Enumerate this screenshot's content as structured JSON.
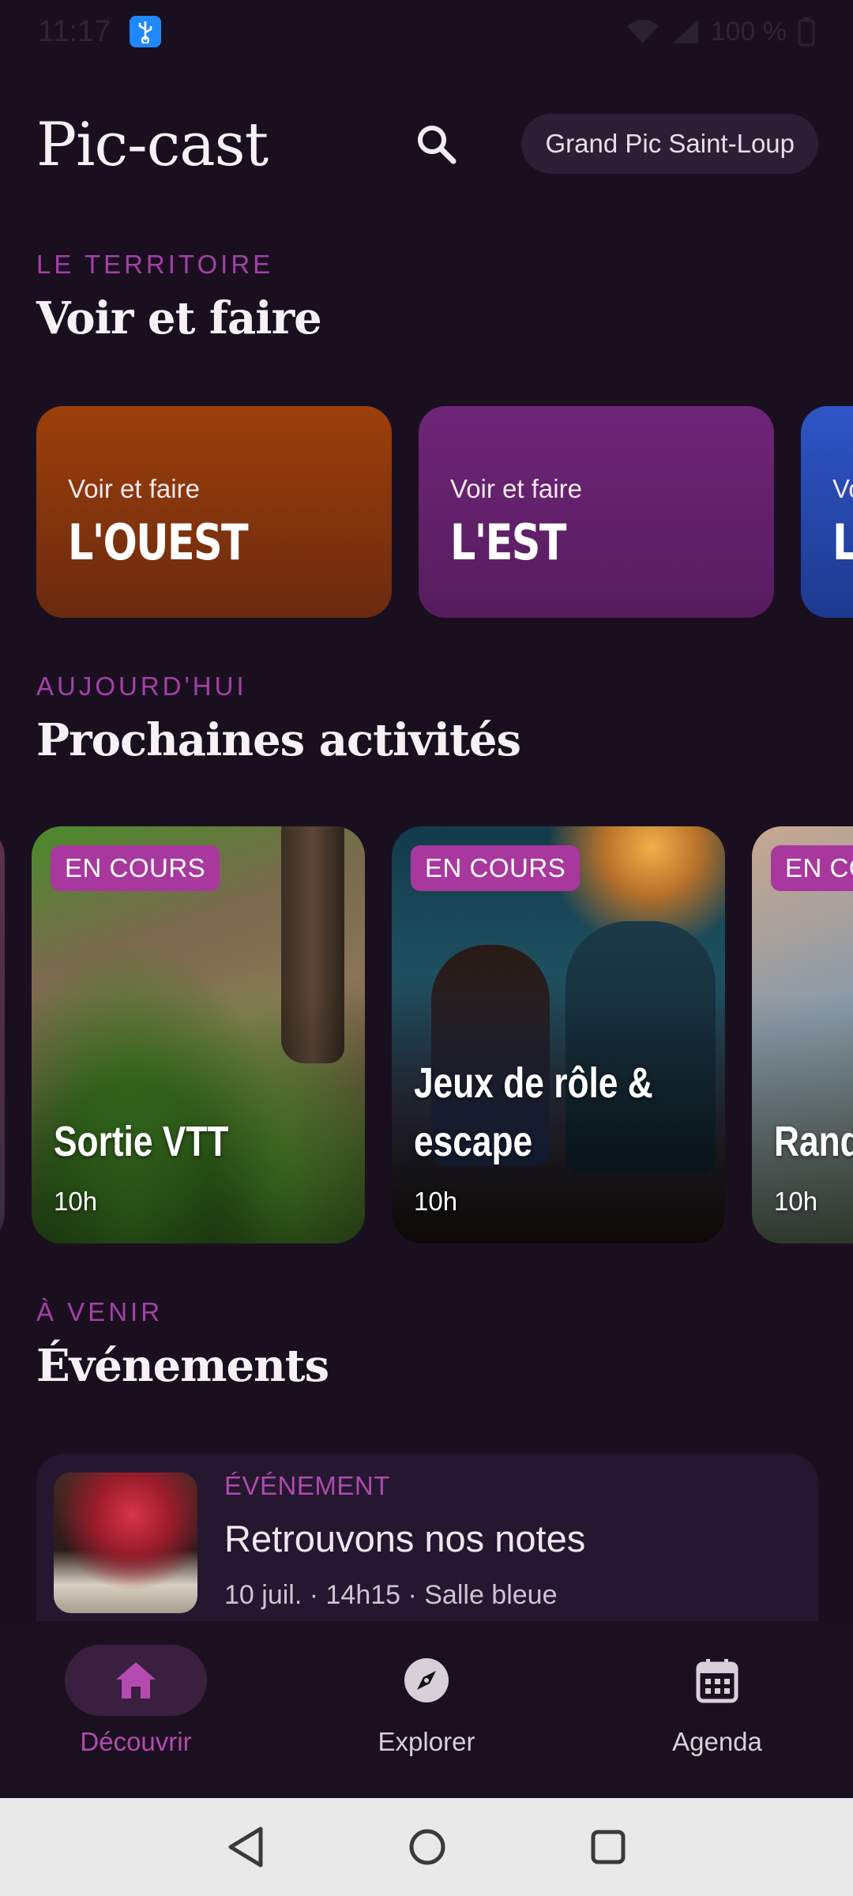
{
  "status_bar": {
    "time": "11:17",
    "battery": "100 %"
  },
  "header": {
    "title": "Pic-cast",
    "location": "Grand Pic Saint-Loup"
  },
  "territory": {
    "eyebrow": "LE TERRITOIRE",
    "title": "Voir et faire",
    "cards": [
      {
        "subtitle": "Voir et faire",
        "name": "L'OUEST"
      },
      {
        "subtitle": "Voir et faire",
        "name": "L'EST"
      },
      {
        "subtitle": "Vo",
        "name": "L"
      }
    ]
  },
  "activities": {
    "eyebrow": "AUJOURD'HUI",
    "title": "Prochaines activités",
    "cards": [
      {
        "badge": "EN COURS",
        "title": "Sortie VTT",
        "time": "10h"
      },
      {
        "badge": "EN COURS",
        "title": "Jeux de rôle & escape",
        "time": "10h"
      },
      {
        "badge": "EN CO",
        "title": "Rand sport",
        "time": "10h"
      }
    ]
  },
  "events": {
    "eyebrow": "À VENIR",
    "title": "Événements",
    "items": [
      {
        "type": "ÉVÉNEMENT",
        "title": "Retrouvons nos notes",
        "meta": "10 juil. · 14h15 · Salle bleue"
      }
    ]
  },
  "bottom_nav": {
    "items": [
      {
        "label": "Découvrir",
        "icon": "home-icon",
        "active": true
      },
      {
        "label": "Explorer",
        "icon": "compass-icon",
        "active": false
      },
      {
        "label": "Agenda",
        "icon": "calendar-icon",
        "active": false
      }
    ]
  },
  "colors": {
    "background": "#1a0f1f",
    "accent": "#a540a8",
    "west_card": "#8a3710",
    "east_card": "#642270",
    "north_card": "#2a4cb8"
  }
}
